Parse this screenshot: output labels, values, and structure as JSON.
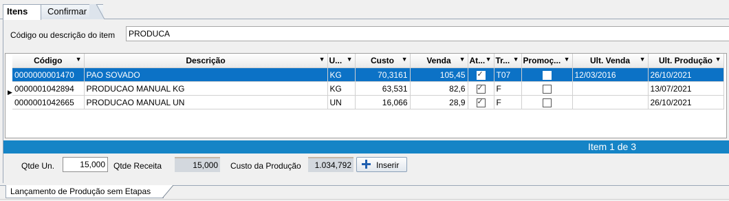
{
  "tabs": {
    "items": "Itens",
    "confirm": "Confirmar"
  },
  "search": {
    "label": "Código ou descrição do item",
    "value": "PRODUCA"
  },
  "grid": {
    "columns": [
      "Código",
      "Descrição",
      "U...",
      "Custo",
      "Venda",
      "At...",
      "Tr...",
      "Promoç...",
      "Ult. Venda",
      "Ult. Produção"
    ],
    "rows": [
      {
        "codigo": "0000000001470",
        "descricao": "PAO SOVADO",
        "un": "KG",
        "custo": "70,3161",
        "venda": "105,45",
        "ativo": true,
        "tr": "T07",
        "promocao": false,
        "ult_venda": "12/03/2016",
        "ult_producao": "26/10/2021"
      },
      {
        "codigo": "0000001042894",
        "descricao": "PRODUCAO MANUAL KG",
        "un": "KG",
        "custo": "63,531",
        "venda": "82,6",
        "ativo": true,
        "tr": "F",
        "promocao": false,
        "ult_venda": "",
        "ult_producao": "13/07/2021"
      },
      {
        "codigo": "0000001042665",
        "descricao": "PRODUCAO MANUAL UN",
        "un": "UN",
        "custo": "16,066",
        "venda": "28,9",
        "ativo": true,
        "tr": "F",
        "promocao": false,
        "ult_venda": "",
        "ult_producao": "26/10/2021"
      }
    ],
    "selected_row": 0
  },
  "status": {
    "text": "Item 1 de 3"
  },
  "bottom": {
    "qtde_un_label": "Qtde Un.",
    "qtde_un_value": "15,000",
    "qtde_receita_label": "Qtde Receita",
    "qtde_receita_value": "15,000",
    "custo_producao_label": "Custo da Produção",
    "custo_producao_value": "1.034,792",
    "insert_label": "Inserir"
  },
  "bottom_tab": {
    "label": "Lançamento de Produção sem Etapas"
  },
  "colors": {
    "selection": "#0c72c6",
    "status_bar": "#1584c6"
  }
}
